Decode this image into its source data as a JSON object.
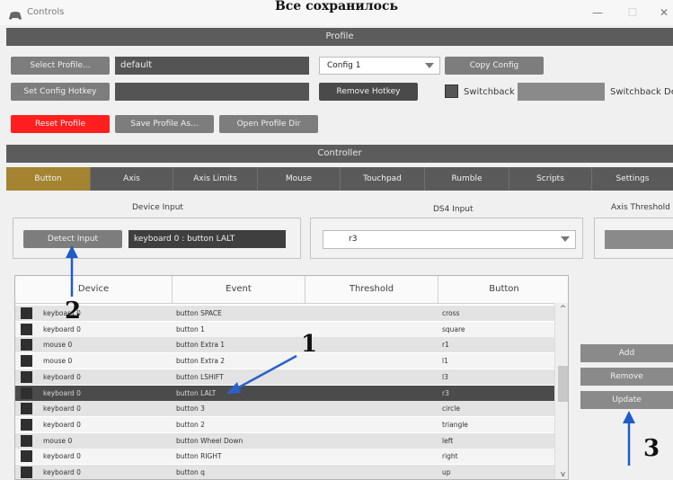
{
  "window": {
    "title": "Controls",
    "caption": "Все сохранилось",
    "minimize": "—",
    "maximize": "☐",
    "close": "✕"
  },
  "profile": {
    "header": "Profile",
    "select_profile_label": "Select Profile...",
    "profile_name": "default",
    "config_value": "Config 1",
    "copy_config_label": "Copy Config",
    "set_hotkey_label": "Set Config Hotkey",
    "hotkey_value": "",
    "remove_hotkey_label": "Remove Hotkey",
    "switchback_label": "Switchback",
    "switchback_delay_label": "Switchback De",
    "reset_profile_label": "Reset Profile",
    "save_profile_as_label": "Save Profile As...",
    "open_profile_dir_label": "Open Profile Dir"
  },
  "controller": {
    "header": "Controller",
    "tabs": [
      "Button",
      "Axis",
      "Axis Limits",
      "Mouse",
      "Touchpad",
      "Rumble",
      "Scripts",
      "Settings"
    ],
    "active_tab": "Button",
    "device_input_title": "Device Input",
    "detect_input_label": "Detect Input",
    "detected_value": "keyboard 0 : button LALT",
    "ds4_input_title": "DS4 Input",
    "ds4_value": "r3",
    "axis_threshold_title": "Axis Threshold"
  },
  "table": {
    "columns": [
      "Device",
      "Event",
      "Threshold",
      "Button"
    ],
    "rows": [
      {
        "device": "keyboard 0",
        "event": "button SPACE",
        "threshold": "",
        "button": "cross"
      },
      {
        "device": "keyboard 0",
        "event": "button 1",
        "threshold": "",
        "button": "square"
      },
      {
        "device": "mouse 0",
        "event": "button Extra 1",
        "threshold": "",
        "button": "r1"
      },
      {
        "device": "mouse 0",
        "event": "button Extra 2",
        "threshold": "",
        "button": "l1"
      },
      {
        "device": "keyboard 0",
        "event": "button LSHIFT",
        "threshold": "",
        "button": "l3"
      },
      {
        "device": "keyboard 0",
        "event": "button LALT",
        "threshold": "",
        "button": "r3"
      },
      {
        "device": "keyboard 0",
        "event": "button 3",
        "threshold": "",
        "button": "circle"
      },
      {
        "device": "keyboard 0",
        "event": "button 2",
        "threshold": "",
        "button": "triangle"
      },
      {
        "device": "mouse 0",
        "event": "button Wheel Down",
        "threshold": "",
        "button": "left"
      },
      {
        "device": "keyboard 0",
        "event": "button RIGHT",
        "threshold": "",
        "button": "right"
      },
      {
        "device": "keyboard 0",
        "event": "button q",
        "threshold": "",
        "button": "up"
      }
    ],
    "selected_index": 5
  },
  "side_buttons": {
    "add": "Add",
    "remove": "Remove",
    "update": "Update"
  },
  "annotations": {
    "n1": "1",
    "n2": "2",
    "n3": "3"
  },
  "colors": {
    "accent_tab": "#a48430",
    "reset_red": "#ff1f1f",
    "arrow_blue": "#2a62c9"
  }
}
